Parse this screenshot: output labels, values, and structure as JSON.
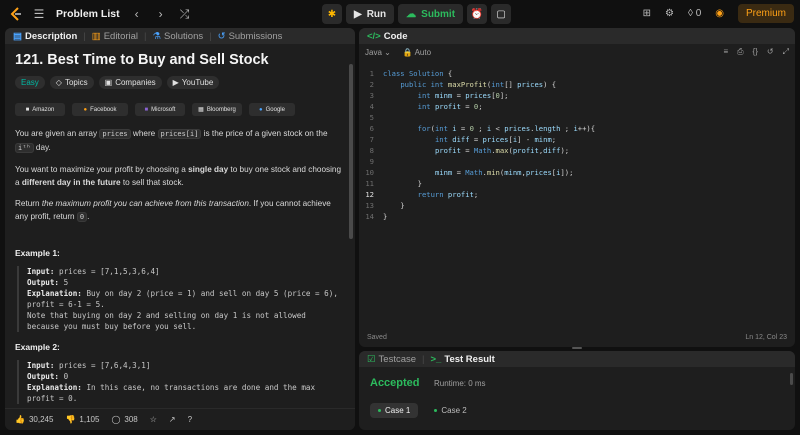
{
  "topbar": {
    "problem_list": "Problem List",
    "run": "Run",
    "submit": "Submit",
    "streak": "0",
    "premium": "Premium"
  },
  "desc_tabs": [
    {
      "label": "Description"
    },
    {
      "label": "Editorial"
    },
    {
      "label": "Solutions"
    },
    {
      "label": "Submissions"
    }
  ],
  "problem": {
    "title": "121. Best Time to Buy and Sell Stock",
    "difficulty": "Easy",
    "tags": [
      "Topics",
      "Companies",
      "YouTube"
    ],
    "companies": [
      "Amazon",
      "Facebook",
      "Microsoft",
      "Bloomberg",
      "Google"
    ],
    "p1": {
      "a": "You are given an array ",
      "code1": "prices",
      "b": " where ",
      "code2": "prices[i]",
      "c": " is the price of a given stock on the ",
      "code3": "iᵗʰ",
      "d": " day."
    },
    "p2": {
      "a": "You want to maximize your profit by choosing a ",
      "b1": "single day",
      "b": " to buy one stock and choosing a ",
      "b2": "different day in the future",
      "c": " to sell that stock."
    },
    "p3": {
      "a": "Return ",
      "em": "the maximum profit you can achieve from this transaction",
      "b": ". If you cannot achieve any profit, return ",
      "code": "0",
      "c": "."
    },
    "example1_title": "Example 1:",
    "example1": {
      "input_label": "Input:",
      "input": " prices = [7,1,5,3,6,4]",
      "output_label": "Output:",
      "output": " 5",
      "expl_label": "Explanation:",
      "expl": " Buy on day 2 (price = 1) and sell on day 5 (price = 6),",
      "expl2": "profit = 6-1 = 5.",
      "note1": "Note that buying on day 2 and selling on day 1 is not allowed",
      "note2": "because you must buy before you sell."
    },
    "example2_title": "Example 2:",
    "example2": {
      "input_label": "Input:",
      "input": " prices = [7,6,4,3,1]",
      "output_label": "Output:",
      "output": " 0",
      "expl_label": "Explanation:",
      "expl": " In this case, no transactions are done and the max",
      "expl2": "profit = 0."
    }
  },
  "footer": {
    "likes": "30,245",
    "dislikes": "1,105",
    "comments": "308"
  },
  "editor": {
    "tab": "Code",
    "language": "Java",
    "mode": "Auto",
    "status_left": "Saved",
    "status_right": "Ln 12, Col 23",
    "current_line": 12
  },
  "result": {
    "tabs": [
      "Testcase",
      "Test Result"
    ],
    "status": "Accepted",
    "runtime": "Runtime: 0 ms",
    "cases": [
      "Case 1",
      "Case 2"
    ]
  },
  "colors": {
    "accent": "#ffa116",
    "accepted": "#2cbb5d",
    "easy": "#00b8a3"
  }
}
